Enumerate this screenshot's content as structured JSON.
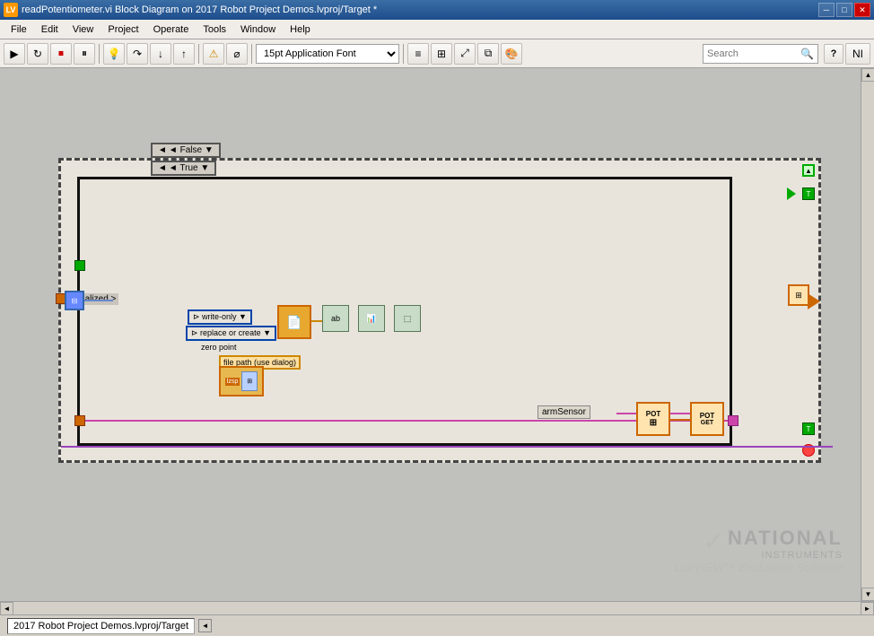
{
  "titleBar": {
    "title": "readPotentiometer.vi Block Diagram on 2017 Robot Project Demos.lvproj/Target *",
    "icon": "LV"
  },
  "menuBar": {
    "items": [
      "File",
      "Edit",
      "View",
      "Project",
      "Operate",
      "Tools",
      "Window",
      "Help"
    ]
  },
  "toolbar": {
    "fontDropdown": "15pt Application Font",
    "searchPlaceholder": "Search"
  },
  "statusBar": {
    "projectLabel": "2017 Robot Project Demos.lvproj/Target"
  },
  "diagram": {
    "labels": {
      "initialized": "> initialized >",
      "writeOnly": "⊳ write-only ▼",
      "replaceOrCreate": "⊳ replace or create ▼",
      "zeroPoint": "zero point",
      "filePathDialog": "file path (use dialog)",
      "armSensor": "armSensor",
      "false": "◄ False ▼",
      "true": "◄ True ▼"
    },
    "potLabels": [
      "POT",
      "POT\nGET"
    ]
  },
  "niLogo": {
    "line1": "NATIONAL",
    "line2": "INSTRUMENTS",
    "line3": "LabVIEW™ Evaluation Software"
  }
}
